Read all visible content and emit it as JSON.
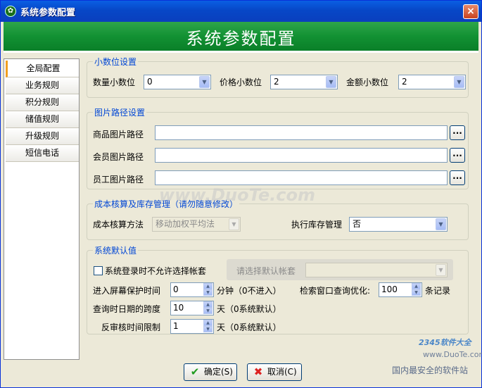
{
  "window": {
    "title": "系统参数配置",
    "banner_title": "系统参数配置",
    "close_label": "×"
  },
  "sidebar": {
    "items": [
      {
        "label": "全局配置"
      },
      {
        "label": "业务规则"
      },
      {
        "label": "积分规则"
      },
      {
        "label": "储值规则"
      },
      {
        "label": "升级规则"
      },
      {
        "label": "短信电话"
      }
    ]
  },
  "decimal": {
    "legend": "小数位设置",
    "qty_label": "数量小数位",
    "qty_value": "0",
    "price_label": "价格小数位",
    "price_value": "2",
    "amount_label": "金额小数位",
    "amount_value": "2"
  },
  "image_path": {
    "legend": "图片路径设置",
    "goods_label": "商品图片路径",
    "member_label": "会员图片路径",
    "staff_label": "员工图片路径",
    "browse_label": "..."
  },
  "cost": {
    "legend": "成本核算及库存管理（请勿随意修改）",
    "method_label": "成本核算方法",
    "method_value": "移动加权平均法",
    "inventory_label": "执行库存管理",
    "inventory_value": "否"
  },
  "defaults": {
    "legend": "系统默认值",
    "no_select_account_label": "系统登录时不允许选择帐套",
    "default_account_label": "请选择默认帐套",
    "default_account_value": "",
    "screensaver_label": "进入屏幕保护时间",
    "screensaver_value": "0",
    "screensaver_unit": "分钟（0不进入）",
    "search_opt_label": "检索窗口查询优化:",
    "search_opt_value": "100",
    "search_opt_unit": "条记录",
    "date_span_label": "查询时日期的跨度",
    "date_span_value": "10",
    "date_span_unit": "天（0系统默认）",
    "reaudit_label": "反审核时间限制",
    "reaudit_value": "1",
    "reaudit_unit": "天（0系统默认）"
  },
  "footer": {
    "ok_label": "确定(S)",
    "cancel_label": "取消(C)"
  },
  "watermarks": {
    "main": "www.DuoTe.com",
    "site_name": "2345软件大全",
    "site_url": "www.DuoTe.com",
    "slogan": "国内最安全的软件站"
  }
}
